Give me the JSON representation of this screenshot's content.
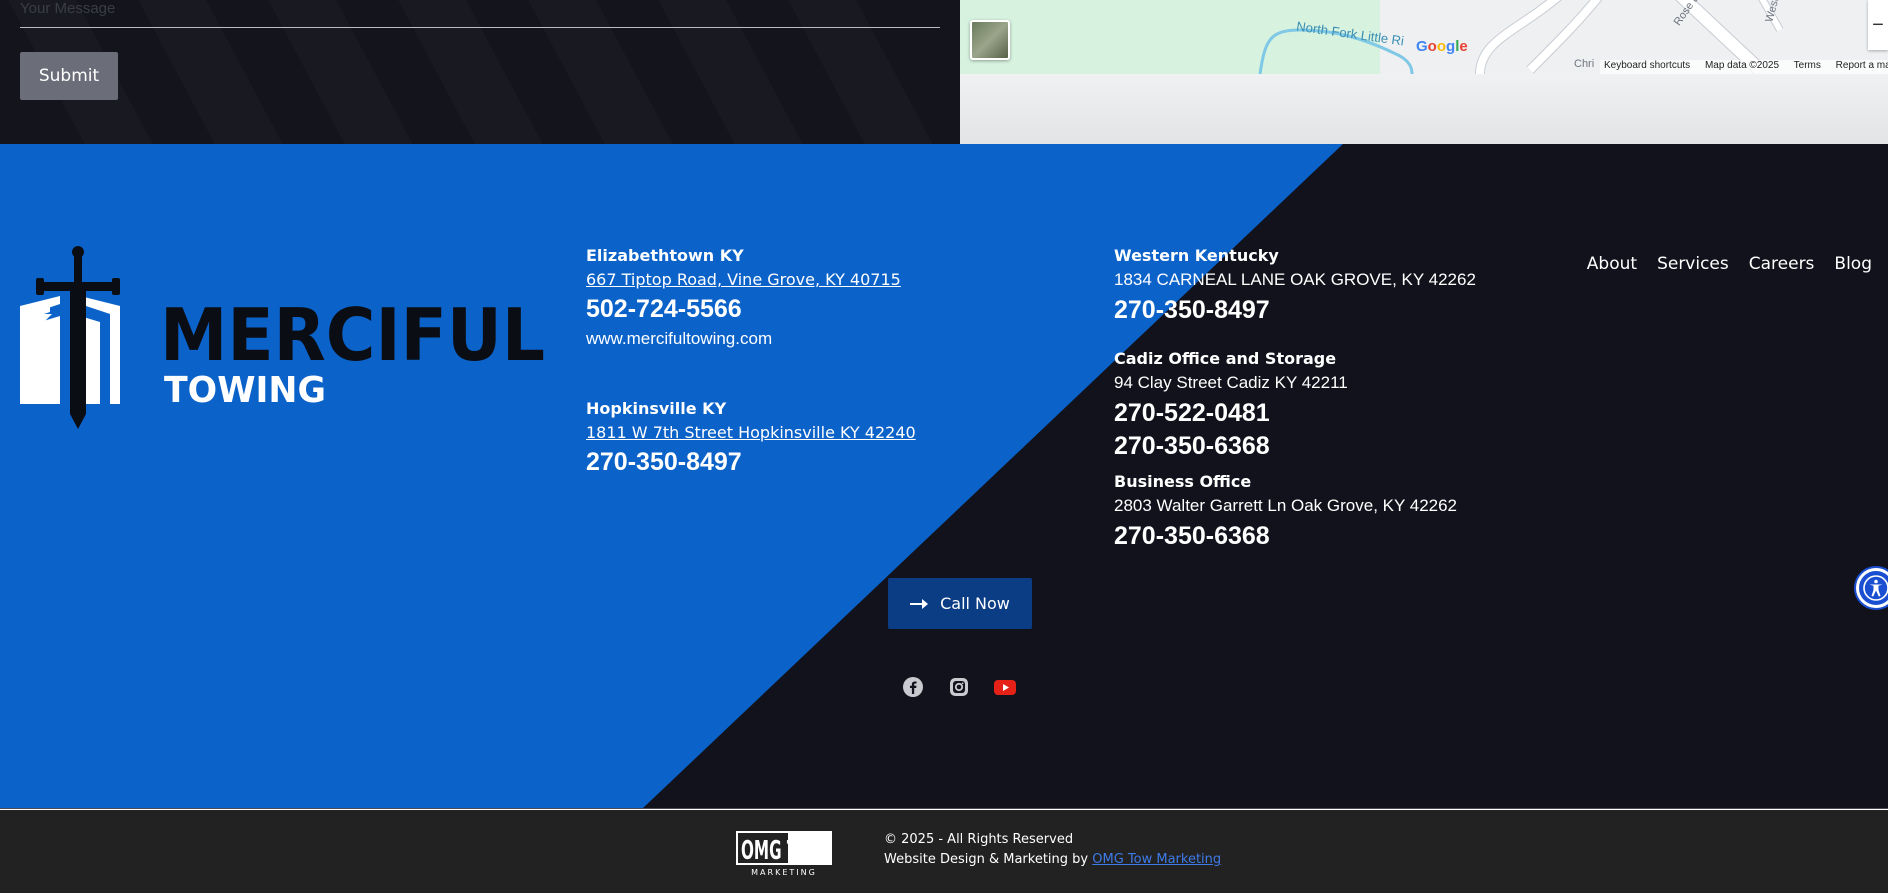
{
  "contact_form": {
    "message_placeholder": "Your Message",
    "submit_label": "Submit"
  },
  "map": {
    "labels": {
      "river": "North Fork Little Ri",
      "road_1": "Rose Dr",
      "road_2": "West",
      "road_3": "Chri"
    },
    "google_logo": [
      "G",
      "o",
      "o",
      "g",
      "l",
      "e"
    ],
    "google_colors": [
      "#4285F4",
      "#EA4335",
      "#FBBC05",
      "#4285F4",
      "#34A853",
      "#EA4335"
    ],
    "footer": {
      "keyboard_shortcuts": "Keyboard shortcuts",
      "map_data": "Map data ©2025",
      "terms": "Terms",
      "report": "Report a map error"
    },
    "zoom_minus": "−"
  },
  "brand": {
    "name_line1": "MERCIFUL",
    "name_line2": "TOWING"
  },
  "locations": {
    "elizabethtown": {
      "title": "Elizabethtown KY",
      "address": "667 Tiptop Road, Vine Grove, KY 40715",
      "phone": "502-724-5566",
      "website": "www.mercifultowing.com"
    },
    "hopkinsville": {
      "title": "Hopkinsville KY",
      "address": "1811 W 7th Street Hopkinsville KY 42240",
      "phone": "270-350-8497"
    },
    "western_kentucky": {
      "title": "Western Kentucky",
      "address": "1834 CARNEAL LANE OAK GROVE, KY 42262",
      "phone": "270-350-8497"
    },
    "cadiz": {
      "title": "Cadiz Office and Storage",
      "address": "94 Clay Street Cadiz KY 42211",
      "phone_1": "270-522-0481",
      "phone_2": "270-350-6368"
    },
    "business_office": {
      "title": "Business Office",
      "address": "2803 Walter Garrett Ln Oak Grove, KY 42262",
      "phone": "270-350-6368"
    }
  },
  "nav": {
    "about": "About",
    "services": "Services",
    "careers": "Careers",
    "blog": "Blog"
  },
  "call_now": {
    "label": "Call Now",
    "icon": "arrow-right-icon"
  },
  "social": {
    "facebook": "facebook-icon",
    "instagram": "instagram-icon",
    "youtube": "youtube-icon",
    "youtube_color": "#e62117"
  },
  "colors": {
    "brand_blue": "#0b62c9",
    "dark": "#11121b",
    "call_now_bg": "#0b3d85",
    "link_blue": "#3d7be8"
  },
  "bottom_bar": {
    "omg_logo_top": "OMG TOW",
    "omg_logo_bottom": "MARKETING",
    "copyright": "© 2025 - All Rights Reserved",
    "credit_prefix": "Website Design & Marketing by",
    "credit_link": "OMG Tow Marketing"
  }
}
